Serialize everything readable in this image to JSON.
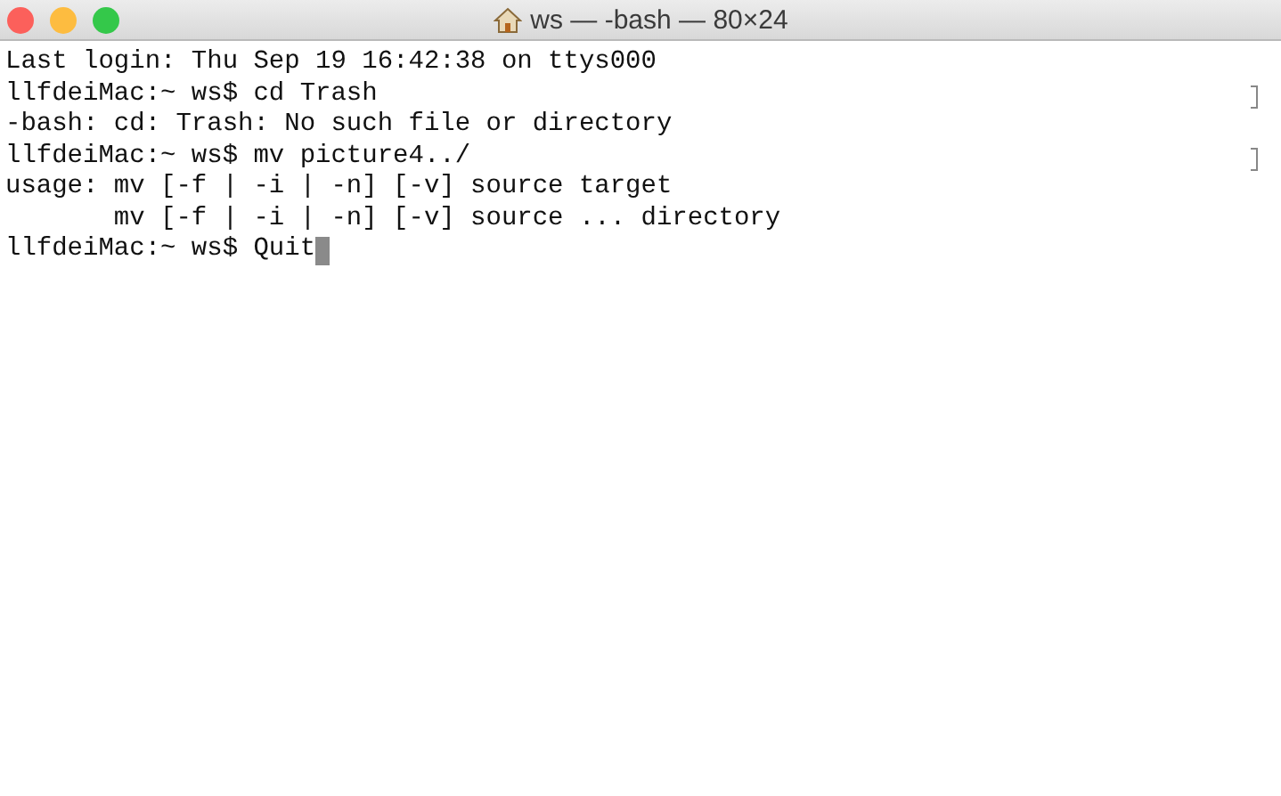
{
  "window": {
    "title": "ws — -bash — 80×24"
  },
  "terminal": {
    "lines": [
      {
        "text": "Last login: Thu Sep 19 16:42:38 on ttys000",
        "marked": false,
        "cursor": false
      },
      {
        "text": "llfdeiMac:~ ws$ cd Trash",
        "marked": true,
        "cursor": false
      },
      {
        "text": "-bash: cd: Trash: No such file or directory",
        "marked": false,
        "cursor": false
      },
      {
        "text": "llfdeiMac:~ ws$ mv picture4../",
        "marked": true,
        "cursor": false
      },
      {
        "text": "usage: mv [-f | -i | -n] [-v] source target",
        "marked": false,
        "cursor": false
      },
      {
        "text": "       mv [-f | -i | -n] [-v] source ... directory",
        "marked": false,
        "cursor": false
      },
      {
        "text": "llfdeiMac:~ ws$ Quit",
        "marked": false,
        "cursor": true
      }
    ]
  }
}
